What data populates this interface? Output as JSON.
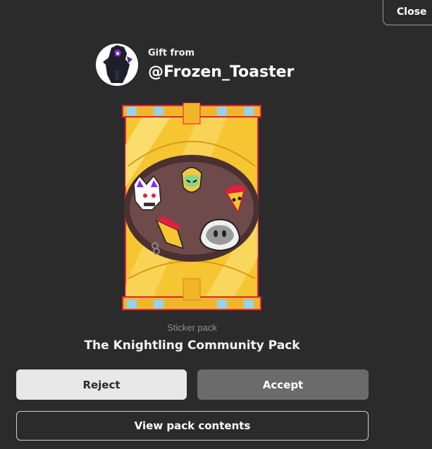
{
  "close_label": "Close",
  "gift": {
    "from_label": "Gift from",
    "sender_name": "@Frozen_Toaster"
  },
  "pack": {
    "type": "Sticker pack",
    "name": "The Knightling Community Pack"
  },
  "actions": {
    "reject_label": "Reject",
    "accept_label": "Accept",
    "view_label": "View pack contents"
  },
  "colors": {
    "background": "#2b2b2b",
    "reject_bg": "#e8e8e8",
    "accept_bg": "#6b6b6b",
    "pack_gold": "#f6c532",
    "pack_border": "#e0203c"
  }
}
